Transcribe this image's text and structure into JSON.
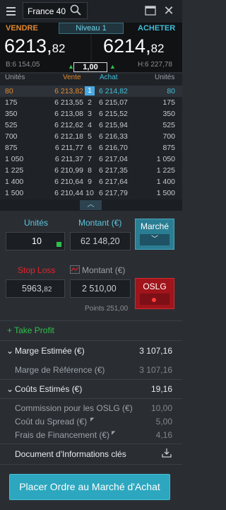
{
  "header": {
    "menu_icon": "hamburger-icon",
    "instrument": "France 40",
    "search_icon": "search-icon",
    "window_icon": "window-icon",
    "close_icon": "close-icon"
  },
  "prices": {
    "sell_label": "VENDRE",
    "buy_label": "ACHETER",
    "level": "Niveau 1",
    "sell_big": "6213,",
    "sell_small": "82",
    "buy_big": "6214,",
    "buy_small": "82",
    "bid_sub": "B:6 154,05",
    "high_sub": "H:6 227,78",
    "spread": "1,00"
  },
  "depth": {
    "headers": {
      "units_left": "Unités",
      "sell": "Vente",
      "buy": "Achat",
      "units_right": "Unités"
    },
    "rows": [
      {
        "units_l": "80",
        "sell": "6 213,82",
        "lvl": "1",
        "buy": "6 214,82",
        "units_r": "80"
      },
      {
        "units_l": "175",
        "sell": "6 213,55",
        "lvl": "2",
        "buy": "6 215,07",
        "units_r": "175"
      },
      {
        "units_l": "350",
        "sell": "6 213,08",
        "lvl": "3",
        "buy": "6 215,52",
        "units_r": "350"
      },
      {
        "units_l": "525",
        "sell": "6 212,62",
        "lvl": "4",
        "buy": "6 215,94",
        "units_r": "525"
      },
      {
        "units_l": "700",
        "sell": "6 212,18",
        "lvl": "5",
        "buy": "6 216,33",
        "units_r": "700"
      },
      {
        "units_l": "875",
        "sell": "6 211,77",
        "lvl": "6",
        "buy": "6 216,70",
        "units_r": "875"
      },
      {
        "units_l": "1 050",
        "sell": "6 211,37",
        "lvl": "7",
        "buy": "6 217,04",
        "units_r": "1 050"
      },
      {
        "units_l": "1 225",
        "sell": "6 210,99",
        "lvl": "8",
        "buy": "6 217,35",
        "units_r": "1 225"
      },
      {
        "units_l": "1 400",
        "sell": "6 210,64",
        "lvl": "9",
        "buy": "6 217,64",
        "units_r": "1 400"
      },
      {
        "units_l": "1 500",
        "sell": "6 210,44",
        "lvl": "10",
        "buy": "6 217,79",
        "units_r": "1 500"
      }
    ],
    "expand_icon": "chevron-up-icon"
  },
  "form": {
    "units_label": "Unités",
    "units_value": "10",
    "amount_label": "Montant (€)",
    "amount_value": "62 148,20",
    "order_type": "Marché",
    "stop_loss_label": "Stop Loss",
    "stop_amount_label": "Montant (€)",
    "stop_price_big": "5963,",
    "stop_price_small": "82",
    "stop_amount_value": "2 510,00",
    "oslg_label": "OSLG",
    "points": "Points 251,00"
  },
  "take_profit": "+ Take Profit",
  "margin": {
    "label": "Marge Estimée (€)",
    "value": "3 107,16",
    "ref_label": "Marge de Référence (€)",
    "ref_value": "3 107,16"
  },
  "costs": {
    "label": "Coûts Estimés (€)",
    "value": "19,16",
    "items": [
      {
        "label": "Commission pour les OSLG (€)",
        "value": "10,00"
      },
      {
        "label": "Coût du Spread (€)",
        "value": "5,00"
      },
      {
        "label": "Frais de Financement (€)",
        "value": "4,16"
      }
    ]
  },
  "document": {
    "label": "Document d'Informations clés",
    "icon": "download-icon"
  },
  "cta": "Placer Ordre au Marché d'Achat",
  "colors": {
    "sell": "#e2882e",
    "buy": "#3fbfd9",
    "stop": "#e0242a",
    "accent": "#2ca7bf",
    "positive": "#2fc14a"
  }
}
